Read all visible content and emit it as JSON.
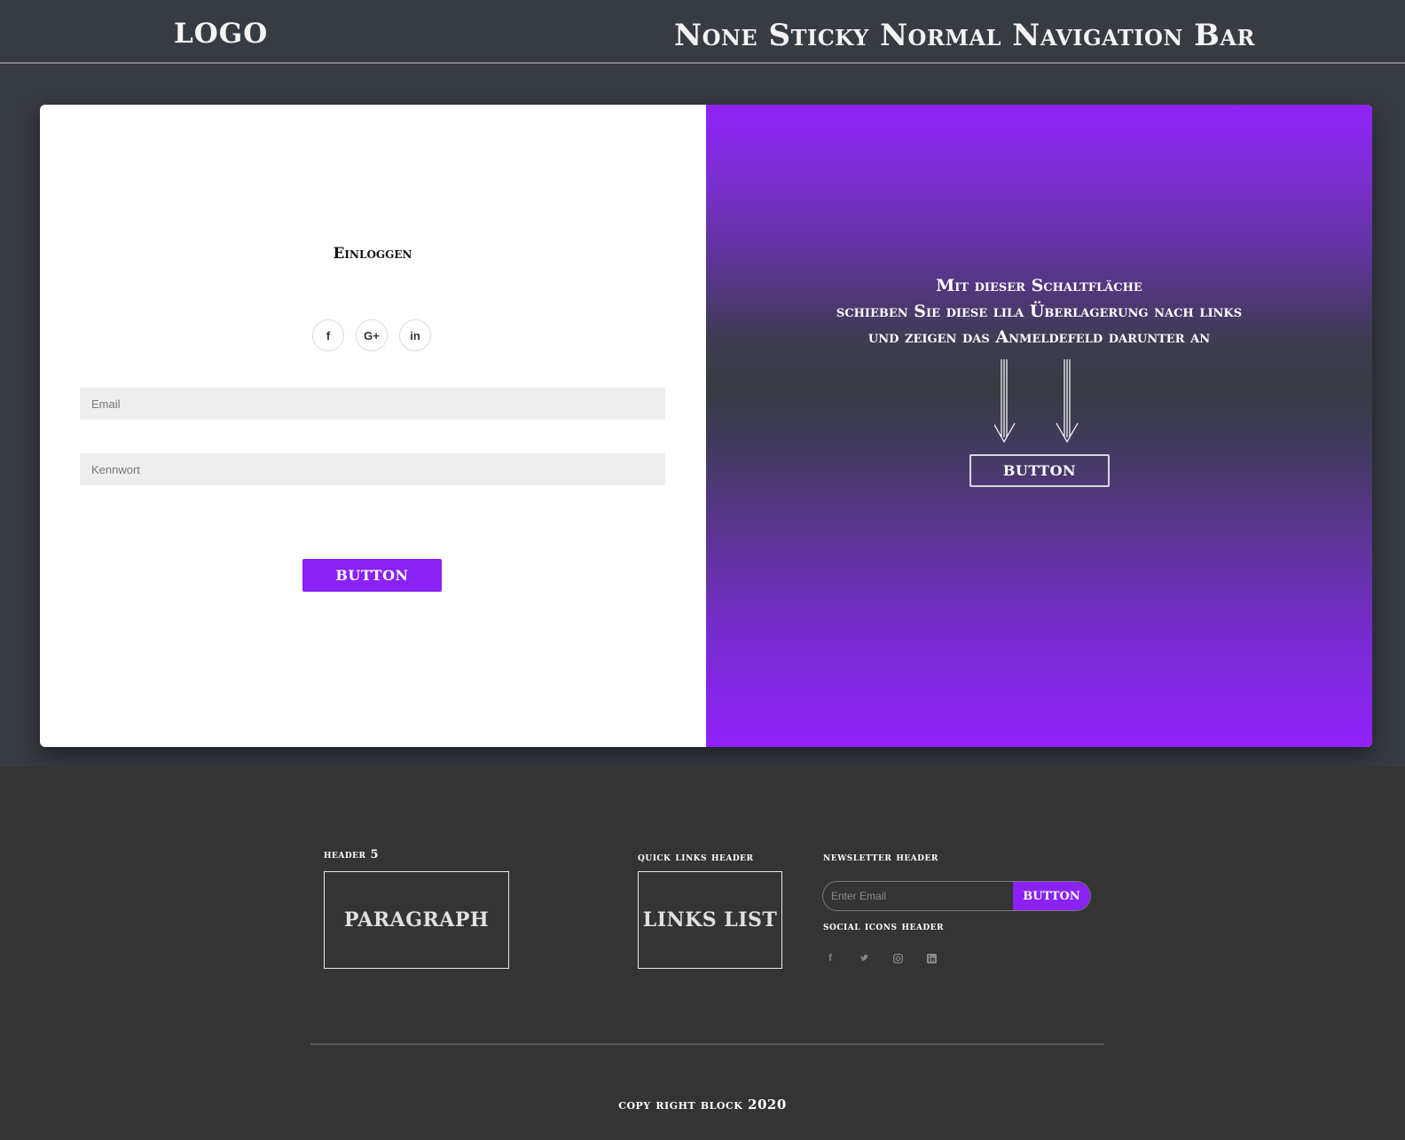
{
  "header": {
    "logo": "LOGO",
    "nav_title": "None Sticky Normal Navigation Bar"
  },
  "login": {
    "title": "Einloggen",
    "social": [
      {
        "icon": "facebook-icon",
        "glyph": "f"
      },
      {
        "icon": "google-plus-icon",
        "glyph": "G+"
      },
      {
        "icon": "linkedin-icon",
        "glyph": "in"
      }
    ],
    "email_placeholder": "Email",
    "password_placeholder": "Kennwort",
    "button_label": "BUTTON"
  },
  "overlay": {
    "line1": "Mit dieser Schaltfläche",
    "line2": "schieben Sie diese lila Überlagerung nach links",
    "line3": "und zeigen das Anmeldefeld darunter an",
    "button_label": "BUTTON"
  },
  "footer": {
    "col1_header": "header 5",
    "col1_box": "PARAGRAPH",
    "col2_header": "quick links header",
    "col2_box": "LINKS LIST",
    "newsletter_header": "newsletter header",
    "newsletter_placeholder": "Enter Email",
    "newsletter_button": "BUTTON",
    "social_header": "social icons header",
    "social_icons": [
      "facebook-icon",
      "twitter-icon",
      "instagram-icon",
      "linkedin-icon"
    ],
    "copyright": "copy right block 2020"
  },
  "colors": {
    "accent": "#8a21f5",
    "band": "#373b42",
    "footer": "#343434"
  }
}
